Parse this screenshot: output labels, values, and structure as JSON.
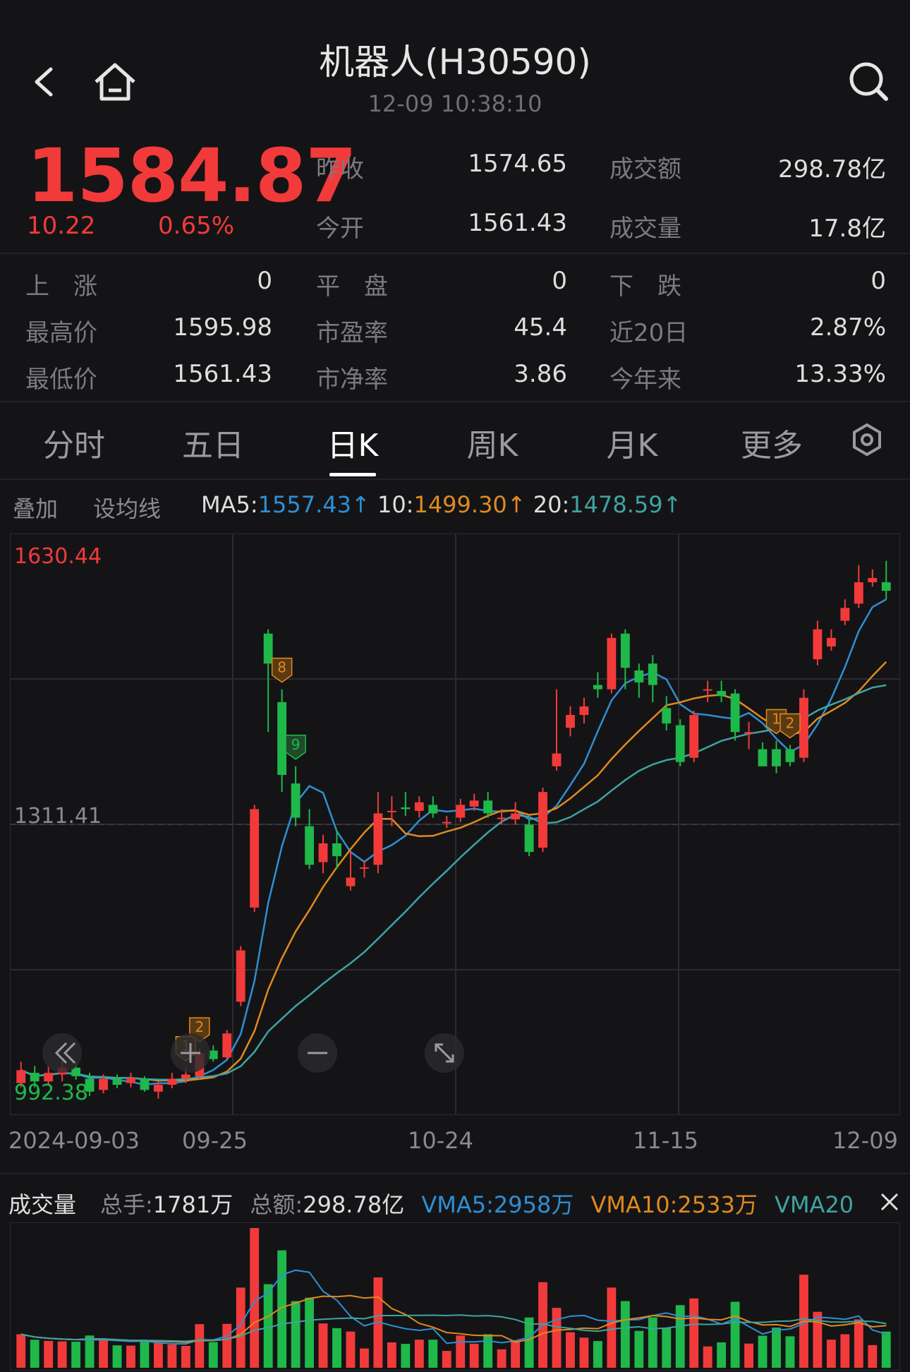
{
  "header": {
    "title": "机器人(H30590)",
    "datetime": "12-09 10:38:10"
  },
  "quote": {
    "price": "1584.87",
    "change": "10.22",
    "change_pct": "0.65%",
    "prev_close_label": "昨收",
    "prev_close": "1574.65",
    "open_label": "今开",
    "open": "1561.43",
    "amount_label": "成交额",
    "amount": "298.78亿",
    "volume_label": "成交量",
    "volume": "17.8亿",
    "up_label": "上　涨",
    "up": "0",
    "flat_label": "平　盘",
    "flat": "0",
    "down_label": "下　跌",
    "down": "0",
    "high_label": "最高价",
    "high": "1595.98",
    "pe_label": "市盈率",
    "pe": "45.4",
    "d20_label": "近20日",
    "d20": "2.87%",
    "low_label": "最低价",
    "low": "1561.43",
    "pb_label": "市净率",
    "pb": "3.86",
    "ytd_label": "今年来",
    "ytd": "13.33%"
  },
  "tabs": [
    "分时",
    "五日",
    "日K",
    "周K",
    "月K",
    "更多"
  ],
  "tools": {
    "overlay": "叠加",
    "set_ma": "设均线"
  },
  "ma": {
    "ma5_label": "MA5:",
    "ma5": "1557.43↑",
    "ma10_label": "10:",
    "ma10": "1499.30↑",
    "ma20_label": "20:",
    "ma20": "1478.59↑"
  },
  "colors": {
    "up": "#f23a3a",
    "down": "#1fb84a",
    "ma5": "#2e8fd6",
    "ma10": "#e08a1e",
    "ma20": "#3fa3a3"
  },
  "chart_data": {
    "type": "candlestick",
    "y_max_label": "1630.44",
    "y_mid_label": "1311.41",
    "y_min_label": "992.38",
    "ylim": [
      992.38,
      1630.44
    ],
    "date_labels": [
      "2024-09-03",
      "09-25",
      "10-24",
      "11-15",
      "12-09"
    ],
    "signals": [
      {
        "index": 12,
        "label": "1",
        "color": "orange"
      },
      {
        "index": 13,
        "label": "2",
        "color": "orange"
      },
      {
        "index": 19,
        "label": "8",
        "color": "orange"
      },
      {
        "index": 20,
        "label": "9",
        "color": "green"
      },
      {
        "index": 55,
        "label": "1",
        "color": "orange"
      },
      {
        "index": 56,
        "label": "2",
        "color": "orange"
      }
    ],
    "candles": [
      [
        1010,
        1025,
        1035,
        1005
      ],
      [
        1022,
        1012,
        1030,
        1005
      ],
      [
        1012,
        1022,
        1030,
        1008
      ],
      [
        1020,
        1028,
        1036,
        1012
      ],
      [
        1028,
        1018,
        1034,
        1014
      ],
      [
        1015,
        1000,
        1022,
        995
      ],
      [
        1002,
        1015,
        1020,
        998
      ],
      [
        1015,
        1008,
        1020,
        1004
      ],
      [
        1010,
        1016,
        1022,
        1005
      ],
      [
        1015,
        1002,
        1018,
        1000
      ],
      [
        1000,
        1008,
        1012,
        992
      ],
      [
        1008,
        1015,
        1022,
        1004
      ],
      [
        1015,
        1020,
        1028,
        1010
      ],
      [
        1018,
        1045,
        1050,
        1015
      ],
      [
        1048,
        1038,
        1054,
        1035
      ],
      [
        1040,
        1068,
        1072,
        1038
      ],
      [
        1105,
        1165,
        1170,
        1100
      ],
      [
        1215,
        1330,
        1335,
        1210
      ],
      [
        1535,
        1500,
        1540,
        1420
      ],
      [
        1455,
        1370,
        1470,
        1350
      ],
      [
        1360,
        1320,
        1380,
        1310
      ],
      [
        1310,
        1265,
        1330,
        1260
      ],
      [
        1268,
        1290,
        1300,
        1255
      ],
      [
        1290,
        1275,
        1305,
        1260
      ],
      [
        1240,
        1250,
        1280,
        1235
      ],
      [
        1262,
        1262,
        1270,
        1250
      ],
      [
        1265,
        1325,
        1350,
        1255
      ],
      [
        1328,
        1328,
        1345,
        1310
      ],
      [
        1332,
        1330,
        1350,
        1322
      ],
      [
        1328,
        1338,
        1345,
        1320
      ],
      [
        1335,
        1325,
        1345,
        1320
      ],
      [
        1315,
        1315,
        1322,
        1308
      ],
      [
        1320,
        1335,
        1342,
        1315
      ],
      [
        1333,
        1340,
        1348,
        1328
      ],
      [
        1340,
        1325,
        1350,
        1320
      ],
      [
        1320,
        1320,
        1330,
        1312
      ],
      [
        1318,
        1325,
        1338,
        1312
      ],
      [
        1312,
        1280,
        1318,
        1275
      ],
      [
        1285,
        1350,
        1355,
        1280
      ],
      [
        1380,
        1395,
        1470,
        1375
      ],
      [
        1425,
        1440,
        1450,
        1415
      ],
      [
        1440,
        1450,
        1460,
        1430
      ],
      [
        1475,
        1470,
        1490,
        1460
      ],
      [
        1470,
        1530,
        1535,
        1465
      ],
      [
        1535,
        1495,
        1540,
        1470
      ],
      [
        1492,
        1478,
        1500,
        1460
      ],
      [
        1500,
        1475,
        1510,
        1455
      ],
      [
        1448,
        1430,
        1462,
        1422
      ],
      [
        1428,
        1385,
        1435,
        1380
      ],
      [
        1390,
        1440,
        1445,
        1385
      ],
      [
        1470,
        1470,
        1480,
        1455
      ],
      [
        1468,
        1462,
        1480,
        1455
      ],
      [
        1465,
        1420,
        1470,
        1410
      ],
      [
        1420,
        1420,
        1432,
        1400
      ],
      [
        1400,
        1380,
        1408,
        1390
      ],
      [
        1400,
        1380,
        1410,
        1372
      ],
      [
        1400,
        1385,
        1405,
        1380
      ],
      [
        1390,
        1460,
        1470,
        1385
      ],
      [
        1505,
        1540,
        1550,
        1498
      ],
      [
        1520,
        1530,
        1540,
        1515
      ],
      [
        1550,
        1565,
        1575,
        1545
      ],
      [
        1570,
        1595,
        1615,
        1565
      ],
      [
        1595,
        1600,
        1610,
        1590
      ],
      [
        1595,
        1585,
        1620,
        1575
      ]
    ],
    "vol_labels": {
      "title": "成交量",
      "total_hands_label": "总手:",
      "total_hands": "1781万",
      "total_amount_label": "总额:",
      "total_amount": "298.78亿",
      "vma5_label": "VMA5:",
      "vma5": "2958万",
      "vma10_label": "VMA10:",
      "vma10": "2533万",
      "vma20_label": "VMA20"
    }
  }
}
